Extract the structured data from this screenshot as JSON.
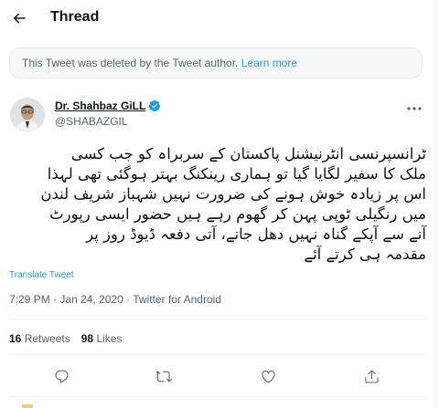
{
  "header": {
    "title": "Thread"
  },
  "deleted_notice": {
    "text": "This Tweet was deleted by the Tweet author.",
    "link": "Learn more"
  },
  "author": {
    "name": "Dr. Shahbaz GiLL",
    "handle": "@SHABAZGIL",
    "verified": true
  },
  "tweet": {
    "lines": [
      "ٹرانسپرنسی انٹرنیشنل پاکستان کے سربراہ کو جب کسی",
      "ملک کا سفیر لگایا گیا تو ہماری رینکنگ بہتر ہوگئی تھی لہذا",
      "اس پر زیادہ خوش ہونے کی ضرورت نہیں شہباز شریف لندن",
      "میں رنگیلی ٹوپی پہن کر گھوم رہے ہیں حضور ایسی رپورٹ",
      "آنے سے آپکے گناہ نہیں دھل جانے، آتی دفعہ ڈیوڈ روز پر",
      "مقدمہ ہی کرتے آئے"
    ],
    "translate_label": "Translate Tweet",
    "time": "7:29 PM",
    "date": "Jan 24, 2020",
    "source": "Twitter for Android",
    "dot": "·"
  },
  "stats": {
    "retweets_count": "16",
    "retweets_label": "Retweets",
    "likes_count": "98",
    "likes_label": "Likes"
  },
  "icons": [
    "back-arrow-icon",
    "verified-badge-icon",
    "more-icon",
    "reply-icon",
    "retweet-icon",
    "like-icon",
    "share-icon"
  ],
  "colors": {
    "accent": "#1d9bf0",
    "text": "#0f1419",
    "secondary": "#536471",
    "border": "#eff3f4"
  }
}
